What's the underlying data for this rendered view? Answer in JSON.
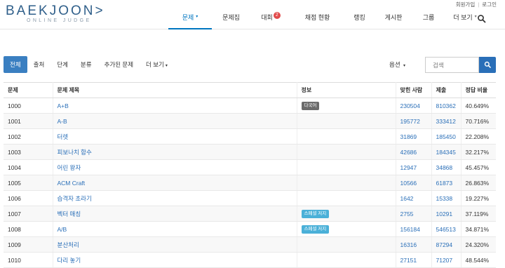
{
  "topbar": {
    "signup": "회원가입",
    "login": "로그인"
  },
  "logo": {
    "main_before": "BAEKJOON",
    "main_after": ">",
    "sub": "ONLINE JUDGE"
  },
  "nav": [
    {
      "label": "문제",
      "caret": "▾",
      "active": true
    },
    {
      "label": "문제집"
    },
    {
      "label": "대회",
      "badge": "2"
    },
    {
      "label": "채점 현황"
    },
    {
      "label": "랭킹"
    },
    {
      "label": "게시판"
    },
    {
      "label": "그룹"
    },
    {
      "label": "더 보기",
      "caret": "▾"
    }
  ],
  "filters": [
    {
      "label": "전체",
      "active": true
    },
    {
      "label": "출처"
    },
    {
      "label": "단계"
    },
    {
      "label": "분류"
    },
    {
      "label": "추가된 문제"
    },
    {
      "label": "더 보기",
      "caret": "▾"
    }
  ],
  "options_label": "옵션",
  "options_caret": "▾",
  "search": {
    "placeholder": "검색"
  },
  "table": {
    "headers": [
      "문제",
      "문제 제목",
      "정보",
      "맞힌 사람",
      "제출",
      "정답 비율"
    ],
    "rows": [
      {
        "id": "1000",
        "title": "A+B",
        "title_link": true,
        "tag": "다국어",
        "tag_style": "dark",
        "solved": "230504",
        "submissions": "810362",
        "ratio": "40.649%"
      },
      {
        "id": "1001",
        "title": "A-B",
        "title_link": true,
        "tag": "",
        "solved": "195772",
        "submissions": "333412",
        "ratio": "70.716%"
      },
      {
        "id": "1002",
        "title": "터렛",
        "title_link": true,
        "tag": "",
        "solved": "31869",
        "submissions": "185450",
        "ratio": "22.208%"
      },
      {
        "id": "1003",
        "title": "피보나치 함수",
        "title_link": true,
        "tag": "",
        "solved": "42686",
        "submissions": "184345",
        "ratio": "32.217%"
      },
      {
        "id": "1004",
        "title": "어린 왕자",
        "title_link": true,
        "tag": "",
        "solved": "12947",
        "submissions": "34868",
        "ratio": "45.457%"
      },
      {
        "id": "1005",
        "title": "ACM Craft",
        "title_link": true,
        "tag": "",
        "solved": "10566",
        "submissions": "61873",
        "ratio": "26.863%"
      },
      {
        "id": "1006",
        "title": "습격자 초라기",
        "title_link": true,
        "tag": "",
        "solved": "1642",
        "submissions": "15338",
        "ratio": "19.227%"
      },
      {
        "id": "1007",
        "title": "벡터 매칭",
        "title_link": true,
        "tag": "스페셜 저지",
        "tag_style": "cyan",
        "solved": "2755",
        "submissions": "10291",
        "ratio": "37.119%"
      },
      {
        "id": "1008",
        "title": "A/B",
        "title_link": true,
        "tag": "스페셜 저지",
        "tag_style": "cyan",
        "solved": "156184",
        "submissions": "546513",
        "ratio": "34.871%"
      },
      {
        "id": "1009",
        "title": "분산처리",
        "title_link": true,
        "tag": "",
        "solved": "16316",
        "submissions": "87294",
        "ratio": "24.320%"
      },
      {
        "id": "1010",
        "title": "다리 놓기",
        "title_link": true,
        "tag": "",
        "solved": "27151",
        "submissions": "71207",
        "ratio": "48.544%"
      }
    ]
  },
  "colors": {
    "accent": "#0076c0",
    "button": "#3a7fc1",
    "search_button": "#2a6fb8",
    "link": "#2a6fb8",
    "badge": "#e14a4a",
    "tag_dark": "#6b6b6b",
    "tag_cyan": "#4ab0d8"
  },
  "icons": {
    "nav_search": "search-icon",
    "search_button": "search-icon"
  }
}
